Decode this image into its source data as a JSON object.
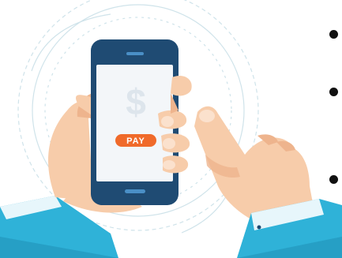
{
  "illustration": {
    "dollar_symbol": "$",
    "pay_button_label": "PAY"
  },
  "colors": {
    "phone_frame": "#1f4b73",
    "phone_screen": "#f3f6f9",
    "pay_button": "#f06a2a",
    "skin": "#f7ccaa",
    "skin_shadow": "#eeb48d",
    "sleeve": "#2fb2d8",
    "sleeve_dark": "#1f8fb7",
    "cuff": "#e7f6fb",
    "orbit_lines": "#cfe3ea",
    "bullet": "#111111"
  },
  "list_bullets": [
    "bullet",
    "bullet",
    "bullet"
  ]
}
